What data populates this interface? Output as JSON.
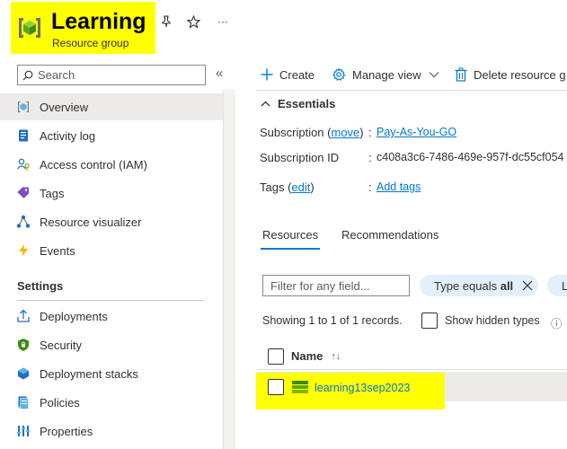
{
  "header": {
    "title": "Learning",
    "subtitle": "Resource group",
    "icons": {
      "resource_group": "resource-group-icon",
      "pin": "pin-icon",
      "favorite": "star-icon",
      "more": "ellipsis-icon"
    },
    "more_label": "···"
  },
  "sidebar": {
    "search_placeholder": "Search",
    "collapse_label": "«",
    "items": [
      {
        "label": "Overview",
        "icon": "overview-icon",
        "active": true
      },
      {
        "label": "Activity log",
        "icon": "activity-log-icon"
      },
      {
        "label": "Access control (IAM)",
        "icon": "iam-icon"
      },
      {
        "label": "Tags",
        "icon": "tag-icon"
      },
      {
        "label": "Resource visualizer",
        "icon": "visualizer-icon"
      },
      {
        "label": "Events",
        "icon": "events-icon"
      }
    ],
    "settings_heading": "Settings",
    "settings_items": [
      {
        "label": "Deployments",
        "icon": "deployments-icon"
      },
      {
        "label": "Security",
        "icon": "security-icon"
      },
      {
        "label": "Deployment stacks",
        "icon": "deployment-stacks-icon"
      },
      {
        "label": "Policies",
        "icon": "policies-icon"
      },
      {
        "label": "Properties",
        "icon": "properties-icon"
      }
    ]
  },
  "toolbar": {
    "create": "Create",
    "manage_view": "Manage view",
    "delete": "Delete resource g"
  },
  "essentials": {
    "title": "Essentials",
    "subscription_label": "Subscription",
    "subscription_move": "move",
    "subscription_value": "Pay-As-You-GO",
    "subscription_id_label": "Subscription ID",
    "subscription_id_value": "c408a3c6-7486-469e-957f-dc55cf054",
    "tags_label": "Tags",
    "tags_edit": "edit",
    "tags_value": "Add tags",
    "colon": ":"
  },
  "tabs": {
    "resources": "Resources",
    "recommendations": "Recommendations"
  },
  "filters": {
    "placeholder": "Filter for any field...",
    "pill_prefix": "Type equals ",
    "pill_value": "all",
    "pill2": "L"
  },
  "records": {
    "text": "Showing 1 to 1 of 1 records.",
    "show_hidden": "Show hidden types",
    "info_label": "ⓘ"
  },
  "table": {
    "col_name": "Name",
    "sort_label": "↑↓",
    "rows": [
      {
        "name": "learning13sep2023",
        "icon": "resource-icon"
      }
    ]
  },
  "highlight_color": "#ffff00",
  "accent_color": "#0078d4"
}
